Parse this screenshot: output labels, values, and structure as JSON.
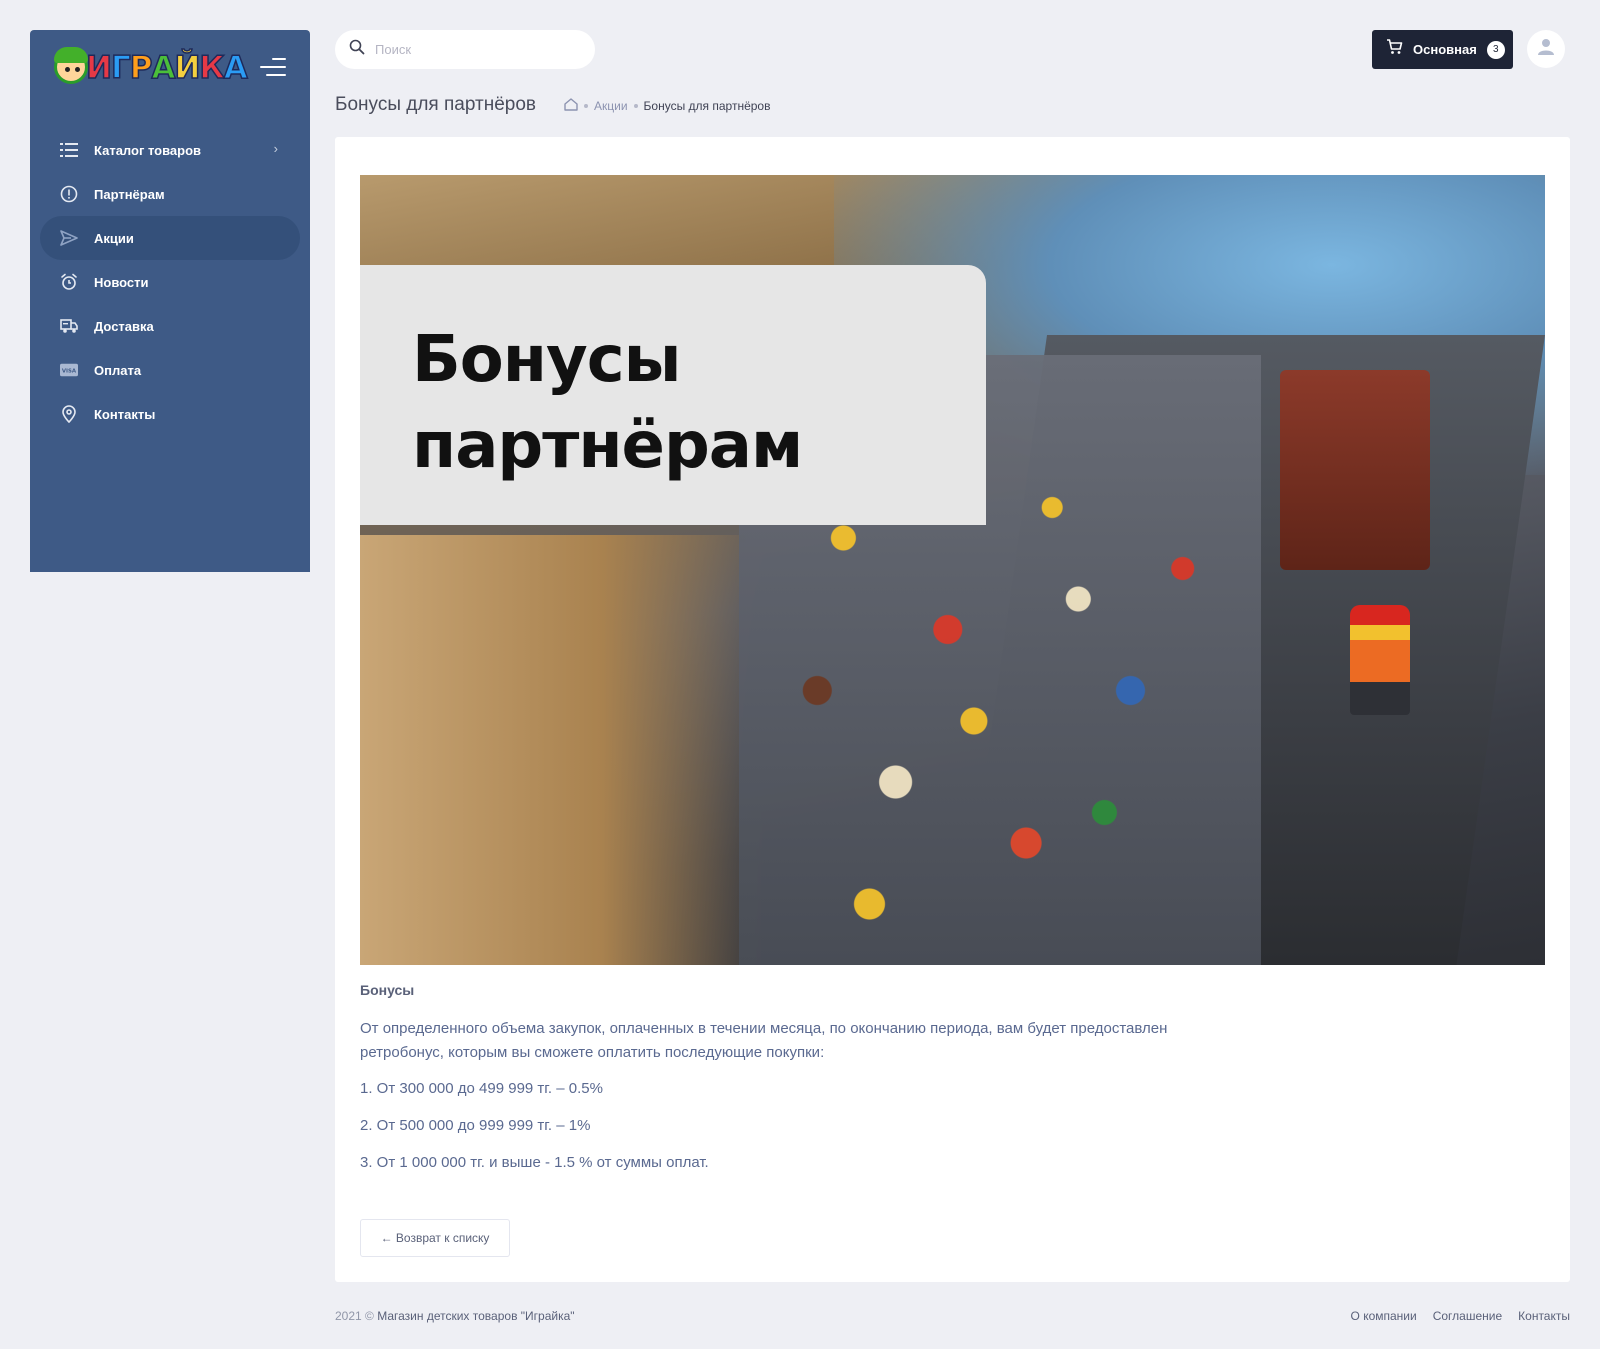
{
  "sidebar": {
    "logo_text": "ИГРАЙКА",
    "items": [
      {
        "label": "Каталог товаров",
        "icon": "list-icon",
        "has_chevron": true
      },
      {
        "label": "Партнёрам",
        "icon": "alert-circle-icon"
      },
      {
        "label": "Акции",
        "icon": "send-icon",
        "active": true
      },
      {
        "label": "Новости",
        "icon": "alarm-icon"
      },
      {
        "label": "Доставка",
        "icon": "truck-icon"
      },
      {
        "label": "Оплата",
        "icon": "visa-card-icon"
      },
      {
        "label": "Контакты",
        "icon": "map-pin-icon"
      }
    ],
    "chevron": "›"
  },
  "header": {
    "search_placeholder": "Поиск",
    "cart_label": "Основная",
    "cart_count": "3"
  },
  "page": {
    "title": "Бонусы для партнёров",
    "breadcrumb": {
      "link": "Акции",
      "current": "Бонусы для партнёров"
    }
  },
  "content": {
    "hero_line1": "Бонусы",
    "hero_line2": "партнёрам",
    "section_title": "Бонусы",
    "paragraph": "От определенного объема закупок, оплаченных в течении месяца, по окончанию периода, вам будет предоставлен ретробонус, которым вы сможете оплатить последующие покупки:",
    "list": [
      "1. От 300 000 до 499 999 тг. – 0.5%",
      "2. От 500 000 до 999 999 тг. – 1%",
      "3. От 1 000 000 тг. и выше - 1.5 % от суммы оплат."
    ],
    "back_button": "← Возврат к списку"
  },
  "footer": {
    "year": "2021 ©",
    "copyright": "Магазин детских товаров \"Играйка\"",
    "links": [
      "О компании",
      "Соглашение",
      "Контакты"
    ]
  },
  "colors": {
    "sidebar_bg": "#3e5a86",
    "sidebar_active": "#34507a",
    "page_bg": "#eeeff4",
    "cart_bg": "#1e2436"
  }
}
